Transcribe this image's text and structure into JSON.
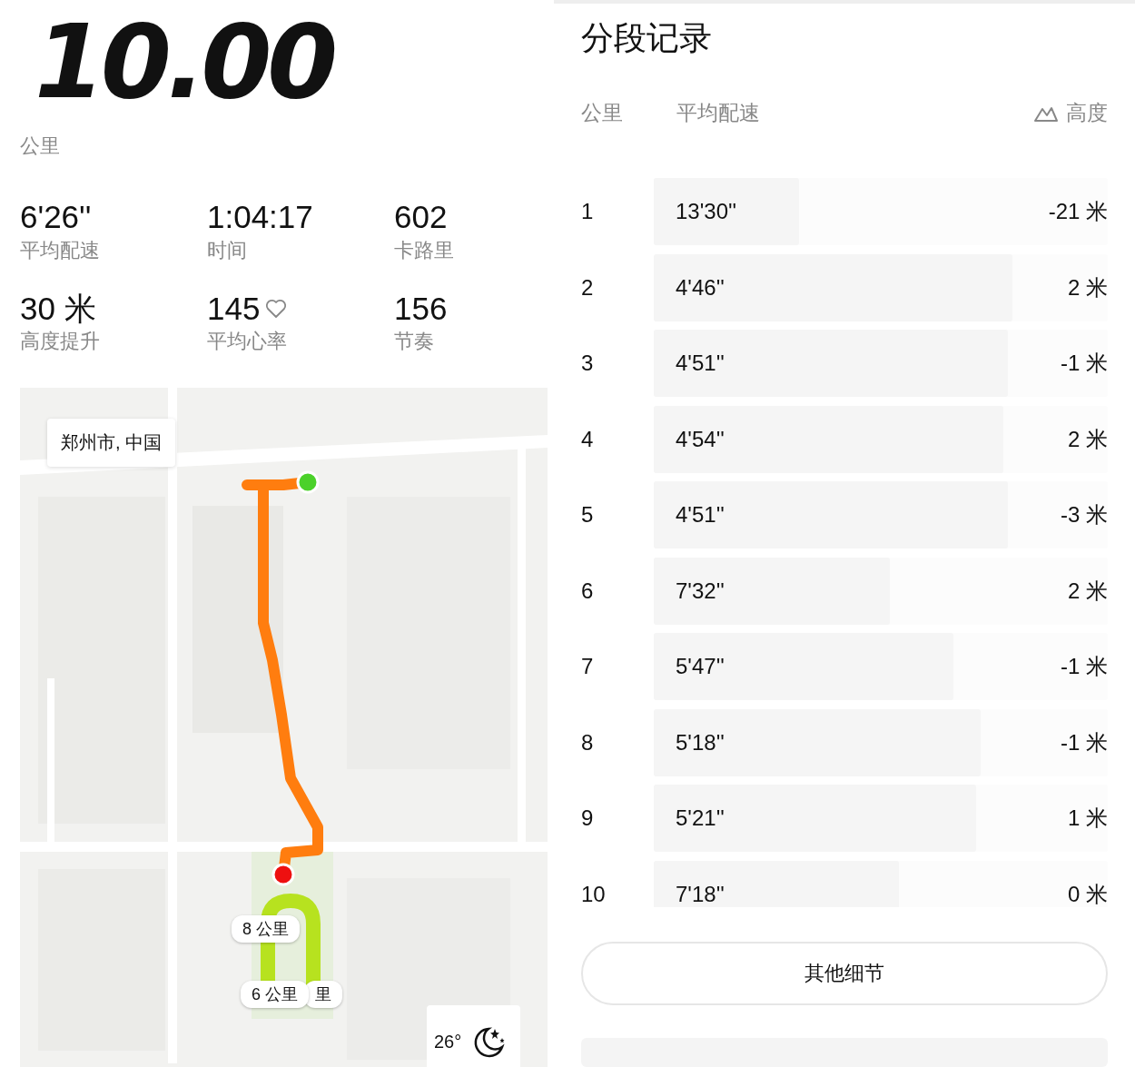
{
  "distance": {
    "value": "10.00",
    "unit": "公里"
  },
  "stats": [
    {
      "value": "6'26''",
      "label": "平均配速",
      "kind": "plain"
    },
    {
      "value": "1:04:17",
      "label": "时间",
      "kind": "plain"
    },
    {
      "value": "602",
      "label": "卡路里",
      "kind": "plain"
    },
    {
      "value": "30 米",
      "label": "高度提升",
      "kind": "plain"
    },
    {
      "value": "145",
      "label": "平均心率",
      "kind": "heart"
    },
    {
      "value": "156",
      "label": "节奏",
      "kind": "plain"
    }
  ],
  "map": {
    "location": "郑州市, 中国",
    "markers": [
      {
        "label": "里"
      },
      {
        "label": "8 公里"
      },
      {
        "label": "6 公里"
      }
    ],
    "weather": {
      "temperature": "26°"
    }
  },
  "splits": {
    "title": "分段记录",
    "columns": [
      "公里",
      "平均配速",
      "高度"
    ],
    "rows": [
      {
        "km": "1",
        "pace": "13'30''",
        "level": 0.32,
        "elevation": "-21 米"
      },
      {
        "km": "2",
        "pace": "4'46''",
        "level": 0.79,
        "elevation": "2 米"
      },
      {
        "km": "3",
        "pace": "4'51''",
        "level": 0.78,
        "elevation": "-1 米"
      },
      {
        "km": "4",
        "pace": "4'54''",
        "level": 0.77,
        "elevation": "2 米"
      },
      {
        "km": "5",
        "pace": "4'51''",
        "level": 0.78,
        "elevation": "-3 米"
      },
      {
        "km": "6",
        "pace": "7'32''",
        "level": 0.52,
        "elevation": "2 米"
      },
      {
        "km": "7",
        "pace": "5'47''",
        "level": 0.66,
        "elevation": "-1 米"
      },
      {
        "km": "8",
        "pace": "5'18''",
        "level": 0.72,
        "elevation": "-1 米"
      },
      {
        "km": "9",
        "pace": "5'21''",
        "level": 0.71,
        "elevation": "1 米"
      },
      {
        "km": "10",
        "pace": "7'18''",
        "level": 0.54,
        "elevation": "0 米"
      }
    ]
  },
  "button": "其他细节"
}
